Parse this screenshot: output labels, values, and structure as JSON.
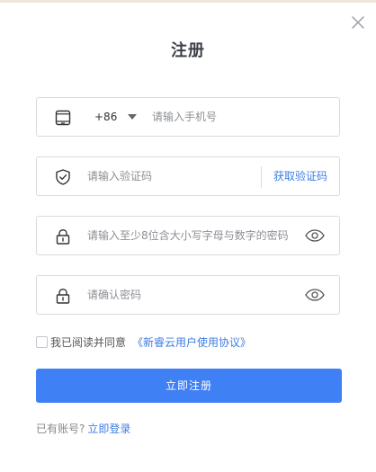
{
  "dialog": {
    "title": "注册",
    "close_icon": "close-icon"
  },
  "phone": {
    "icon": "mobile-phone-icon",
    "country_code": "+86",
    "dropdown_icon": "caret-down-icon",
    "placeholder": "请输入手机号"
  },
  "code": {
    "icon": "shield-check-icon",
    "placeholder": "请输入验证码",
    "get_code_label": "获取验证码"
  },
  "password": {
    "icon": "lock-icon",
    "placeholder": "请输入至少8位含大小写字母与数字的密码",
    "toggle_icon": "eye-icon"
  },
  "confirm_password": {
    "icon": "lock-icon",
    "placeholder": "请确认密码",
    "toggle_icon": "eye-icon"
  },
  "agreement": {
    "text": "我已阅读并同意",
    "link": "《新睿云用户使用协议》",
    "checked": false
  },
  "submit_label": "立即注册",
  "footer": {
    "text": "已有账号?",
    "link": "立即登录"
  },
  "colors": {
    "accent": "#3f80f5",
    "link": "#3d7de6",
    "border": "#d9dbe0"
  }
}
